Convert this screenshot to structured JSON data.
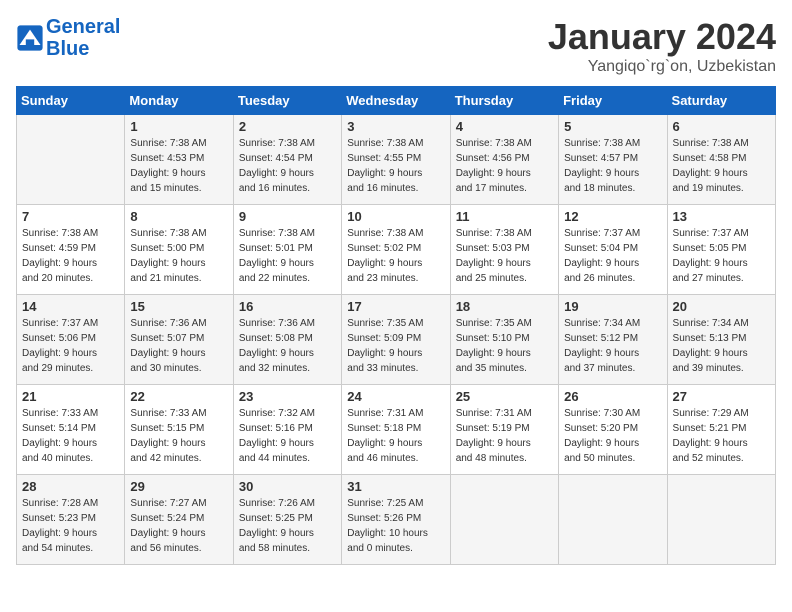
{
  "header": {
    "logo_line1": "General",
    "logo_line2": "Blue",
    "month": "January 2024",
    "location": "Yangiqo`rg`on, Uzbekistan"
  },
  "weekdays": [
    "Sunday",
    "Monday",
    "Tuesday",
    "Wednesday",
    "Thursday",
    "Friday",
    "Saturday"
  ],
  "weeks": [
    [
      {
        "day": "",
        "info": ""
      },
      {
        "day": "1",
        "info": "Sunrise: 7:38 AM\nSunset: 4:53 PM\nDaylight: 9 hours\nand 15 minutes."
      },
      {
        "day": "2",
        "info": "Sunrise: 7:38 AM\nSunset: 4:54 PM\nDaylight: 9 hours\nand 16 minutes."
      },
      {
        "day": "3",
        "info": "Sunrise: 7:38 AM\nSunset: 4:55 PM\nDaylight: 9 hours\nand 16 minutes."
      },
      {
        "day": "4",
        "info": "Sunrise: 7:38 AM\nSunset: 4:56 PM\nDaylight: 9 hours\nand 17 minutes."
      },
      {
        "day": "5",
        "info": "Sunrise: 7:38 AM\nSunset: 4:57 PM\nDaylight: 9 hours\nand 18 minutes."
      },
      {
        "day": "6",
        "info": "Sunrise: 7:38 AM\nSunset: 4:58 PM\nDaylight: 9 hours\nand 19 minutes."
      }
    ],
    [
      {
        "day": "7",
        "info": "Sunrise: 7:38 AM\nSunset: 4:59 PM\nDaylight: 9 hours\nand 20 minutes."
      },
      {
        "day": "8",
        "info": "Sunrise: 7:38 AM\nSunset: 5:00 PM\nDaylight: 9 hours\nand 21 minutes."
      },
      {
        "day": "9",
        "info": "Sunrise: 7:38 AM\nSunset: 5:01 PM\nDaylight: 9 hours\nand 22 minutes."
      },
      {
        "day": "10",
        "info": "Sunrise: 7:38 AM\nSunset: 5:02 PM\nDaylight: 9 hours\nand 23 minutes."
      },
      {
        "day": "11",
        "info": "Sunrise: 7:38 AM\nSunset: 5:03 PM\nDaylight: 9 hours\nand 25 minutes."
      },
      {
        "day": "12",
        "info": "Sunrise: 7:37 AM\nSunset: 5:04 PM\nDaylight: 9 hours\nand 26 minutes."
      },
      {
        "day": "13",
        "info": "Sunrise: 7:37 AM\nSunset: 5:05 PM\nDaylight: 9 hours\nand 27 minutes."
      }
    ],
    [
      {
        "day": "14",
        "info": "Sunrise: 7:37 AM\nSunset: 5:06 PM\nDaylight: 9 hours\nand 29 minutes."
      },
      {
        "day": "15",
        "info": "Sunrise: 7:36 AM\nSunset: 5:07 PM\nDaylight: 9 hours\nand 30 minutes."
      },
      {
        "day": "16",
        "info": "Sunrise: 7:36 AM\nSunset: 5:08 PM\nDaylight: 9 hours\nand 32 minutes."
      },
      {
        "day": "17",
        "info": "Sunrise: 7:35 AM\nSunset: 5:09 PM\nDaylight: 9 hours\nand 33 minutes."
      },
      {
        "day": "18",
        "info": "Sunrise: 7:35 AM\nSunset: 5:10 PM\nDaylight: 9 hours\nand 35 minutes."
      },
      {
        "day": "19",
        "info": "Sunrise: 7:34 AM\nSunset: 5:12 PM\nDaylight: 9 hours\nand 37 minutes."
      },
      {
        "day": "20",
        "info": "Sunrise: 7:34 AM\nSunset: 5:13 PM\nDaylight: 9 hours\nand 39 minutes."
      }
    ],
    [
      {
        "day": "21",
        "info": "Sunrise: 7:33 AM\nSunset: 5:14 PM\nDaylight: 9 hours\nand 40 minutes."
      },
      {
        "day": "22",
        "info": "Sunrise: 7:33 AM\nSunset: 5:15 PM\nDaylight: 9 hours\nand 42 minutes."
      },
      {
        "day": "23",
        "info": "Sunrise: 7:32 AM\nSunset: 5:16 PM\nDaylight: 9 hours\nand 44 minutes."
      },
      {
        "day": "24",
        "info": "Sunrise: 7:31 AM\nSunset: 5:18 PM\nDaylight: 9 hours\nand 46 minutes."
      },
      {
        "day": "25",
        "info": "Sunrise: 7:31 AM\nSunset: 5:19 PM\nDaylight: 9 hours\nand 48 minutes."
      },
      {
        "day": "26",
        "info": "Sunrise: 7:30 AM\nSunset: 5:20 PM\nDaylight: 9 hours\nand 50 minutes."
      },
      {
        "day": "27",
        "info": "Sunrise: 7:29 AM\nSunset: 5:21 PM\nDaylight: 9 hours\nand 52 minutes."
      }
    ],
    [
      {
        "day": "28",
        "info": "Sunrise: 7:28 AM\nSunset: 5:23 PM\nDaylight: 9 hours\nand 54 minutes."
      },
      {
        "day": "29",
        "info": "Sunrise: 7:27 AM\nSunset: 5:24 PM\nDaylight: 9 hours\nand 56 minutes."
      },
      {
        "day": "30",
        "info": "Sunrise: 7:26 AM\nSunset: 5:25 PM\nDaylight: 9 hours\nand 58 minutes."
      },
      {
        "day": "31",
        "info": "Sunrise: 7:25 AM\nSunset: 5:26 PM\nDaylight: 10 hours\nand 0 minutes."
      },
      {
        "day": "",
        "info": ""
      },
      {
        "day": "",
        "info": ""
      },
      {
        "day": "",
        "info": ""
      }
    ]
  ]
}
